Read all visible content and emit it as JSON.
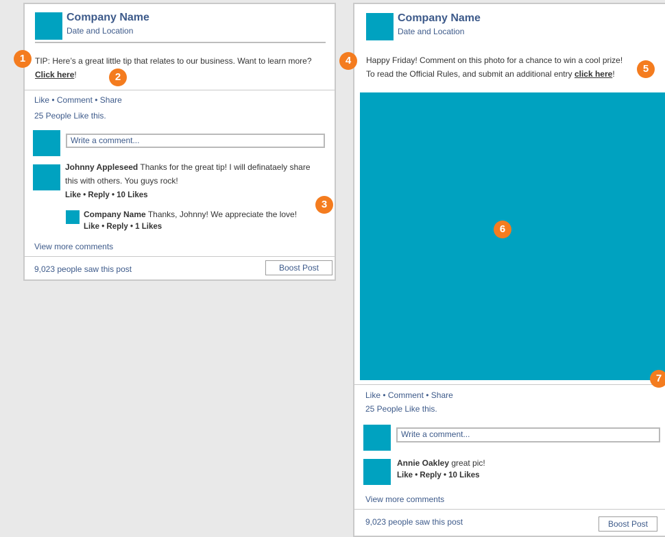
{
  "colors": {
    "accent": "#00a2c0",
    "badge": "#f47c1f",
    "link": "#3d5a8a",
    "background": "#e9e9e9"
  },
  "post1": {
    "company": "Company Name",
    "date_location": "Date and Location",
    "text_before": "TIP: Here’s a great little tip that relates to our business. Want to learn more? ",
    "link": "Click here",
    "text_after": "!",
    "actions": "Like • Comment • Share",
    "likes": "25 People Like this.",
    "comment_placeholder": "Write a comment...",
    "comment1": {
      "author": "Johnny Appleseed",
      "text": " Thanks for the great tip! I will definataely share this with others. You guys rock!",
      "meta": "Like • Reply • 10 Likes"
    },
    "reply1": {
      "author": "Company Name",
      "text": " Thanks, Johnny! We appreciate the love!",
      "meta": "Like • Reply • 1 Likes"
    },
    "view_more": "View more comments",
    "views": "9,023 people saw this post",
    "boost": "Boost Post"
  },
  "post2": {
    "company": "Company Name",
    "date_location": "Date and Location",
    "line1": "Happy Friday! Comment on this photo for a chance to win a cool prize!",
    "line2_before": "To read the Official Rules, and submit an additional entry ",
    "link": "click here",
    "line2_after": "!",
    "actions": "Like • Comment • Share",
    "likes": "25 People Like this.",
    "comment_placeholder": "Write a comment...",
    "comment1": {
      "author": "Annie Oakley",
      "text": " great pic!",
      "meta": "Like • Reply • 10 Likes"
    },
    "view_more": "View more comments",
    "views": "9,023 people saw this post",
    "boost": "Boost Post"
  },
  "badges": [
    "1",
    "2",
    "3",
    "4",
    "5",
    "6",
    "7"
  ]
}
